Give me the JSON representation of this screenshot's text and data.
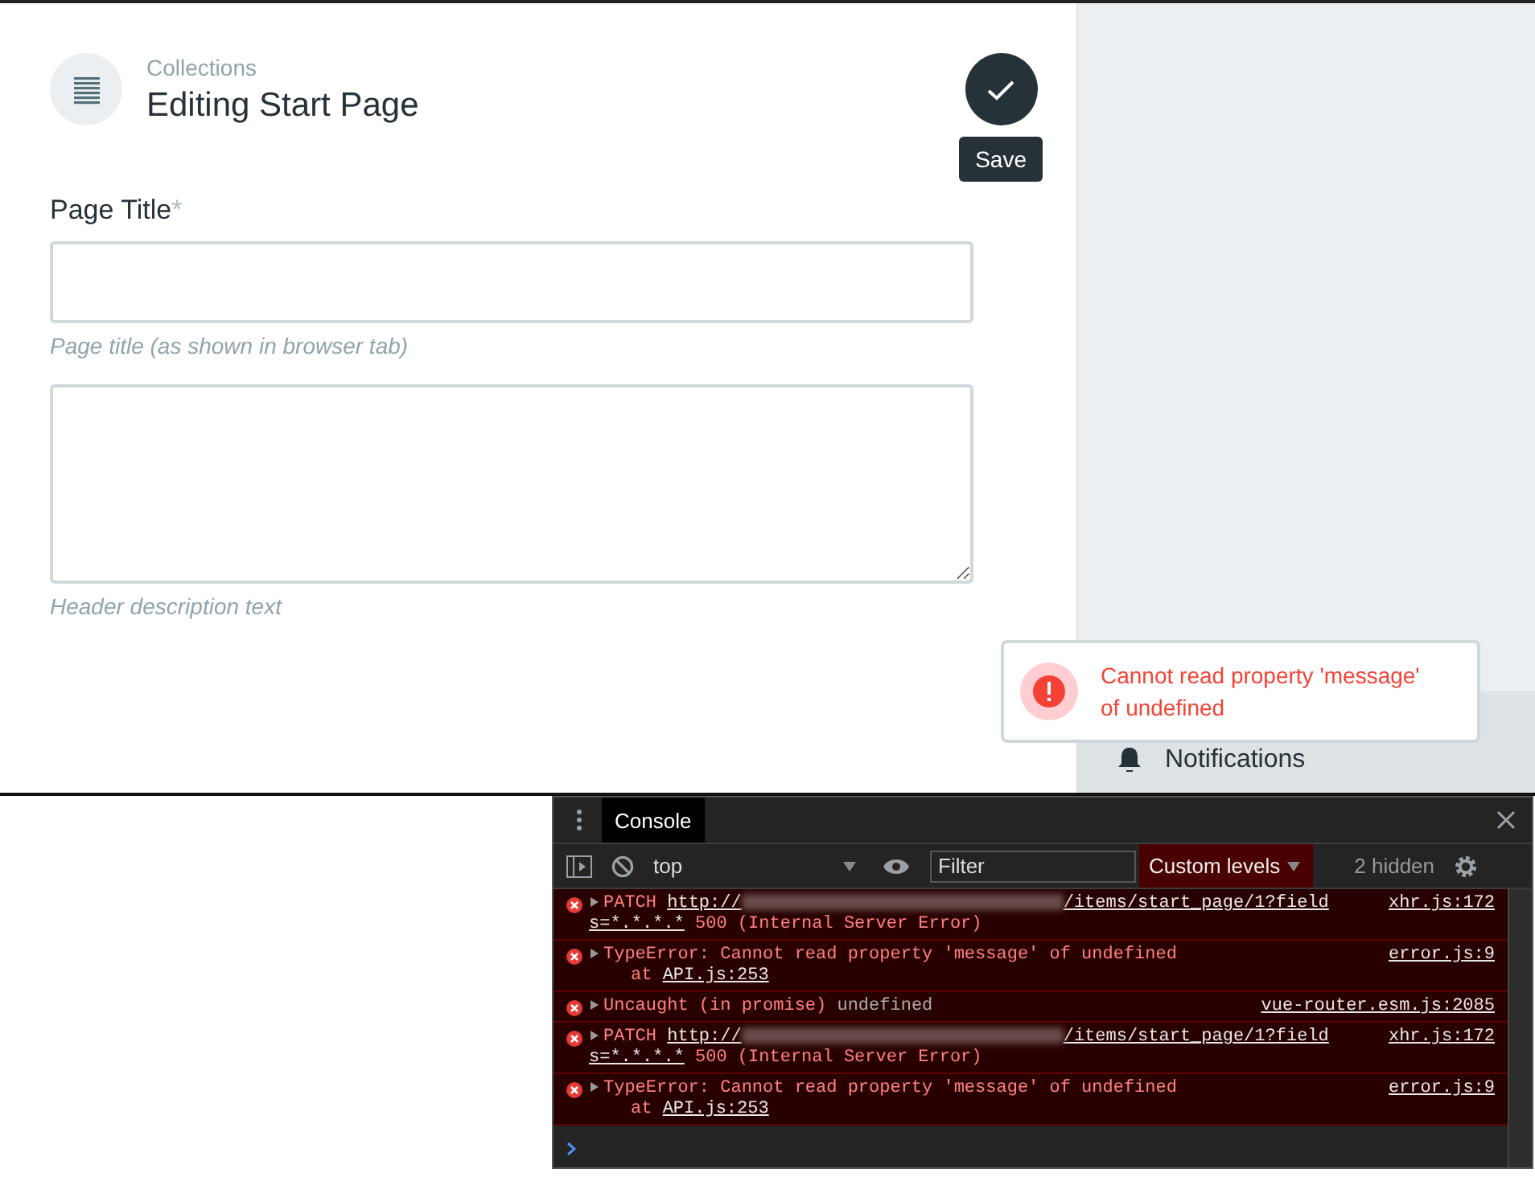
{
  "header": {
    "breadcrumb": "Collections",
    "title": "Editing Start Page"
  },
  "save_button": {
    "tooltip": "Save"
  },
  "fields": [
    {
      "kind": "input",
      "label": "Page Title",
      "required": true,
      "required_mark": "*",
      "note": "Page title (as shown in browser tab)"
    },
    {
      "kind": "textarea",
      "note": "Header description text"
    }
  ],
  "sidebar": {
    "item": "Notifications"
  },
  "toast": {
    "message": "Cannot read property 'message' of undefined"
  },
  "devtools": {
    "tab": "Console",
    "context": "top",
    "filter_placeholder": "Filter",
    "levels": "Custom levels",
    "hidden_count": "2 hidden",
    "messages": [
      {
        "kind": "request",
        "method": "PATCH",
        "url_start": "http://",
        "url_end": "/items/start_page/1?field",
        "url_tail": "s=*.*.*.*",
        "status": "500 (Internal Server Error)",
        "source": "xhr.js:172"
      },
      {
        "kind": "error",
        "text": "TypeError: Cannot read property 'message' of undefined",
        "at": "at",
        "at_link": "API.js:253",
        "source": "error.js:9"
      },
      {
        "kind": "uncaught",
        "text": "Uncaught (in promise)",
        "value": "undefined",
        "source": "vue-router.esm.js:2085"
      },
      {
        "kind": "request",
        "method": "PATCH",
        "url_start": "http://",
        "url_end": "/items/start_page/1?field",
        "url_tail": "s=*.*.*.*",
        "status": "500 (Internal Server Error)",
        "source": "xhr.js:172"
      },
      {
        "kind": "error",
        "text": "TypeError: Cannot read property 'message' of undefined",
        "at": "at",
        "at_link": "API.js:253",
        "source": "error.js:9"
      }
    ]
  }
}
